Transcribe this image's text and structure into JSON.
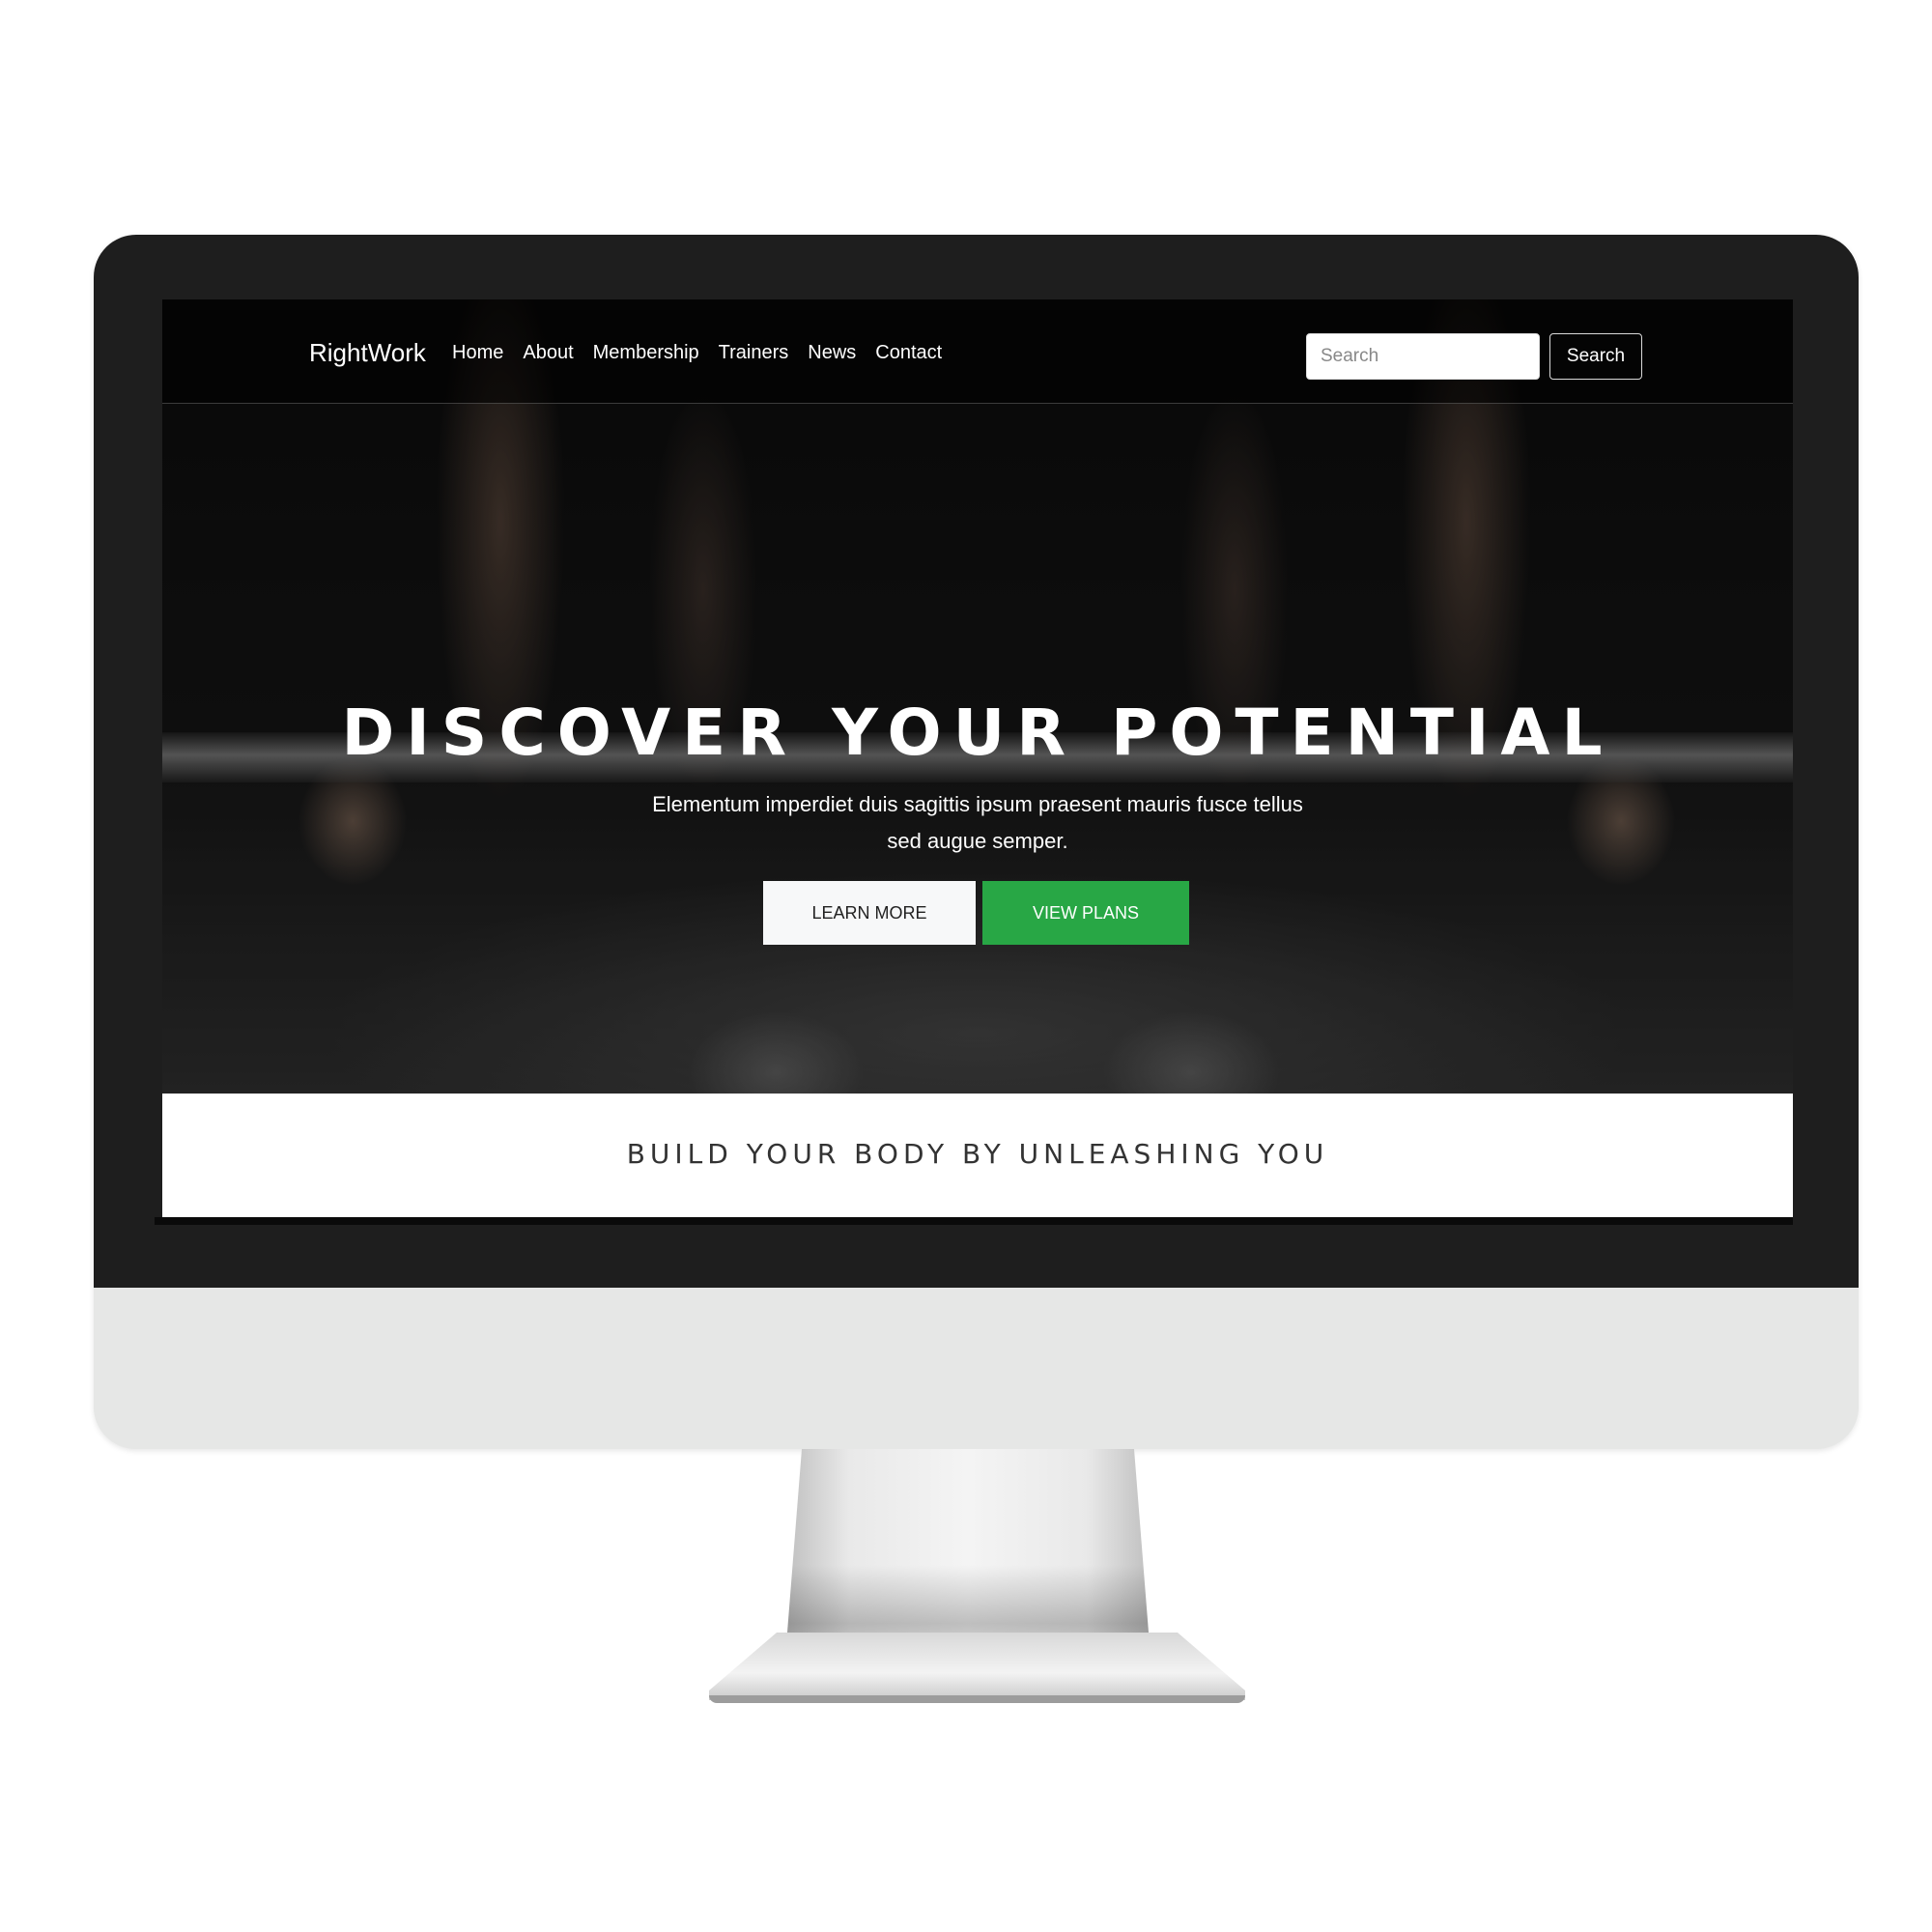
{
  "nav": {
    "brand": "RightWork",
    "links": [
      "Home",
      "About",
      "Membership",
      "Trainers",
      "News",
      "Contact"
    ],
    "search_placeholder": "Search",
    "search_button": "Search"
  },
  "hero": {
    "title": "DISCOVER YOUR POTENTIAL",
    "subtitle": "Elementum imperdiet duis sagittis ipsum praesent mauris fusce tellus sed augue semper.",
    "learn_more": "LEARN MORE",
    "view_plans": "VIEW PLANS"
  },
  "section": {
    "heading": "BUILD YOUR BODY BY UNLEASHING YOU"
  },
  "colors": {
    "accent": "#28a745",
    "bezel": "#1e1e1e",
    "chin": "#e6e7e6"
  }
}
